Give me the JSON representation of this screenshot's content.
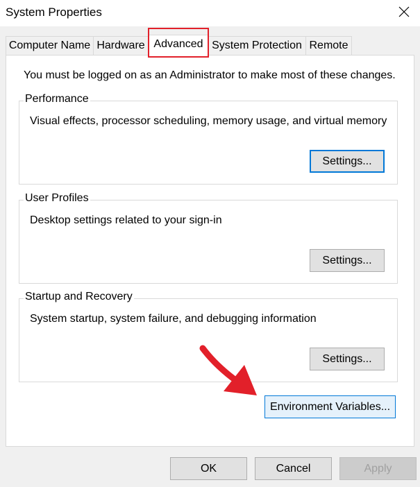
{
  "window": {
    "title": "System Properties"
  },
  "tabs": [
    {
      "label": "Computer Name"
    },
    {
      "label": "Hardware"
    },
    {
      "label": "Advanced"
    },
    {
      "label": "System Protection"
    },
    {
      "label": "Remote"
    }
  ],
  "active_tab": "Advanced",
  "notice": "You must be logged on as an Administrator to make most of these changes.",
  "groups": {
    "performance": {
      "title": "Performance",
      "description": "Visual effects, processor scheduling, memory usage, and virtual memory",
      "button": "Settings..."
    },
    "user_profiles": {
      "title": "User Profiles",
      "description": "Desktop settings related to your sign-in",
      "button": "Settings..."
    },
    "startup_recovery": {
      "title": "Startup and Recovery",
      "description": "System startup, system failure, and debugging information",
      "button": "Settings..."
    }
  },
  "environment_button": "Environment Variables...",
  "footer": {
    "ok": "OK",
    "cancel": "Cancel",
    "apply": "Apply"
  },
  "colors": {
    "annotation_red": "#e2202a",
    "focus_blue": "#0078d7"
  },
  "icons": {
    "close": "close-icon",
    "annotation": "red-arrow-icon"
  }
}
